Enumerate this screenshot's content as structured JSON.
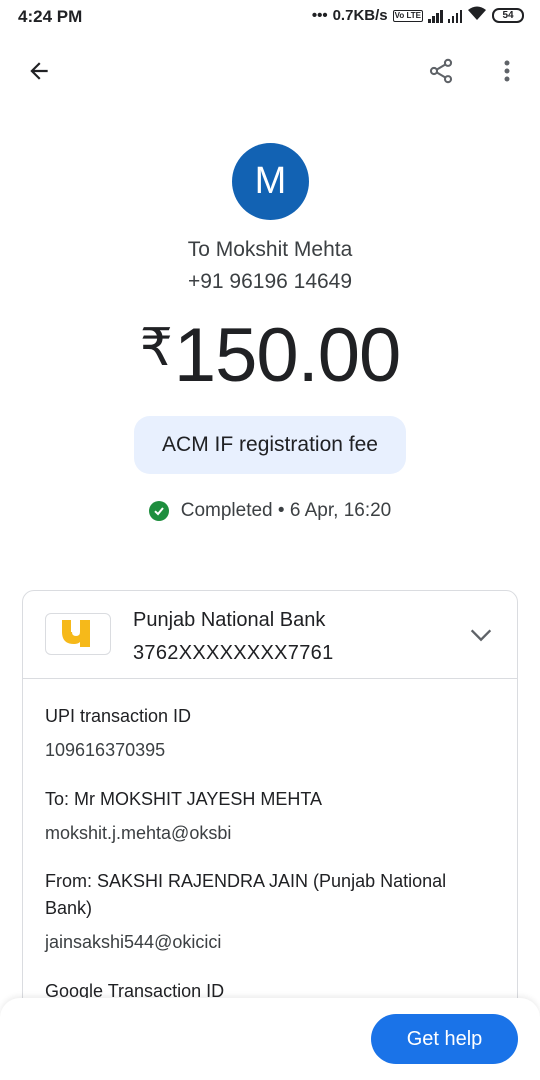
{
  "status_bar": {
    "time": "4:24 PM",
    "network_speed": "0.7KB/s",
    "volte": "Vo LTE",
    "battery": "54"
  },
  "app_bar": {
    "back_icon": "arrow-back-icon",
    "share_icon": "share-icon",
    "more_icon": "more-vert-icon"
  },
  "transaction": {
    "avatar_letter": "M",
    "avatar_color": "#1262b3",
    "recipient": "To Mokshit Mehta",
    "phone": "+91 96196 14649",
    "currency_symbol": "₹",
    "amount": "150.00",
    "note": "ACM IF registration fee",
    "status": "Completed • 6 Apr, 16:20",
    "status_color": "#1e8e3e"
  },
  "bank": {
    "name": "Punjab National Bank",
    "account": "3762XXXXXXXX7761",
    "logo_color": "#f6b91a"
  },
  "details": {
    "upi_label": "UPI transaction ID",
    "upi_value": "109616370395",
    "to_label": "To: Mr MOKSHIT JAYESH MEHTA",
    "to_value": "mokshit.j.mehta@oksbi",
    "from_label": "From: SAKSHI RAJENDRA JAIN (Punjab National Bank)",
    "from_value": "jainsakshi544@okicici",
    "google_label": "Google Transaction ID"
  },
  "footer": {
    "help_label": "Get help",
    "accent": "#1a73e8"
  }
}
